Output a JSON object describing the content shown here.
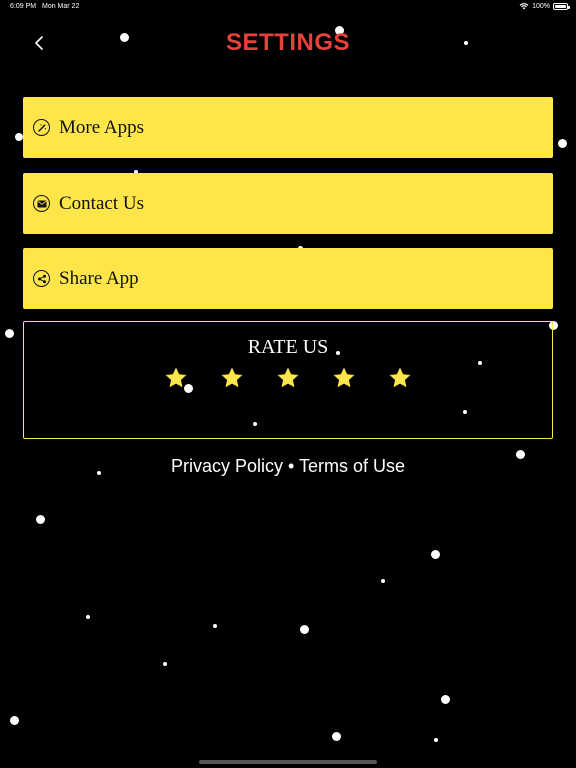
{
  "status_bar": {
    "time": "6:09 PM",
    "date": "Mon Mar 22",
    "battery": "100%",
    "battery_level": 1.0
  },
  "header": {
    "title": "SETTINGS"
  },
  "menu": [
    {
      "label": "More Apps",
      "icon": "magic-wand-icon"
    },
    {
      "label": "Contact Us",
      "icon": "mail-icon"
    },
    {
      "label": "Share App",
      "icon": "share-icon"
    }
  ],
  "rate": {
    "title": "RATE US",
    "star_count": 5
  },
  "footer": {
    "privacy": "Privacy Policy",
    "separator": "•",
    "terms": "Terms of Use"
  },
  "colors": {
    "title_red": "#e8403a",
    "yellow": "#fde54a",
    "background": "#000000",
    "star": "#fde54a"
  }
}
